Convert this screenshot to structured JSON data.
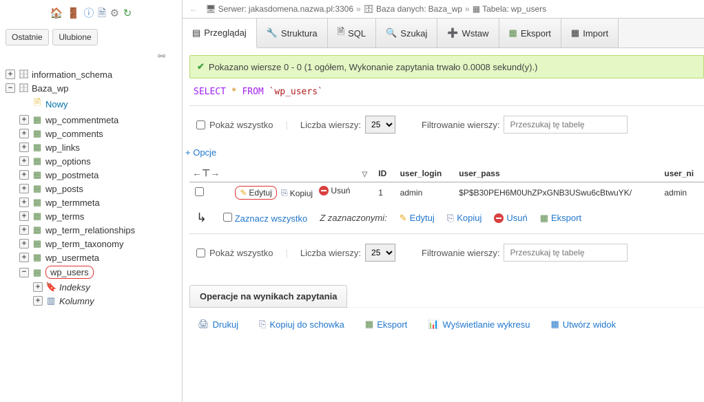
{
  "sidebar": {
    "tabs": {
      "recent": "Ostatnie",
      "favorites": "Ulubione"
    },
    "tree": {
      "info_schema": "information_schema",
      "baza_wp": "Baza_wp",
      "nowy": "Nowy",
      "tables": [
        "wp_commentmeta",
        "wp_comments",
        "wp_links",
        "wp_options",
        "wp_postmeta",
        "wp_posts",
        "wp_termmeta",
        "wp_terms",
        "wp_term_relationships",
        "wp_term_taxonomy",
        "wp_usermeta"
      ],
      "wp_users": "wp_users",
      "indeksy": "Indeksy",
      "kolumny": "Kolumny"
    }
  },
  "breadcrumb": {
    "server_label": "Serwer:",
    "server_value": "jakasdomena.nazwa.pl:3306",
    "db_label": "Baza danych:",
    "db_value": "Baza_wp",
    "table_label": "Tabela:",
    "table_value": "wp_users"
  },
  "tabs": {
    "browse": "Przeglądaj",
    "structure": "Struktura",
    "sql": "SQL",
    "search": "Szukaj",
    "insert": "Wstaw",
    "export": "Eksport",
    "import": "Import"
  },
  "success_msg": "Pokazano wiersze 0 - 0 (1 ogółem, Wykonanie zapytania trwało 0.0008 sekund(y).)",
  "sql": {
    "select": "SELECT",
    "star": "*",
    "from": "FROM",
    "table": "`wp_users`"
  },
  "controls": {
    "show_all": "Pokaż wszystko",
    "row_count": "Liczba wierszy:",
    "row_count_val": "25",
    "filter_label": "Filtrowanie wierszy:",
    "filter_placeholder": "Przeszukaj tę tabelę"
  },
  "options": "+ Opcje",
  "table": {
    "headers": {
      "id": "ID",
      "user_login": "user_login",
      "user_pass": "user_pass",
      "user_ni": "user_ni"
    },
    "actions": {
      "edit": "Edytuj",
      "copy": "Kopiuj",
      "delete": "Usuń"
    },
    "row": {
      "id": "1",
      "user_login": "admin",
      "user_pass": "$P$B30PEH6M0UhZPxGNB3USwu6cBtwuYK/",
      "user_ni": "admin"
    }
  },
  "select_all": {
    "label": "Zaznacz wszystko",
    "with_selected": "Z zaznaczonymi:",
    "edit": "Edytuj",
    "copy": "Kopiuj",
    "delete": "Usuń",
    "export": "Eksport"
  },
  "ops": {
    "header": "Operacje na wynikach zapytania",
    "print": "Drukuj",
    "clipboard": "Kopiuj do schowka",
    "export": "Eksport",
    "chart": "Wyświetlanie wykresu",
    "view": "Utwórz widok"
  }
}
